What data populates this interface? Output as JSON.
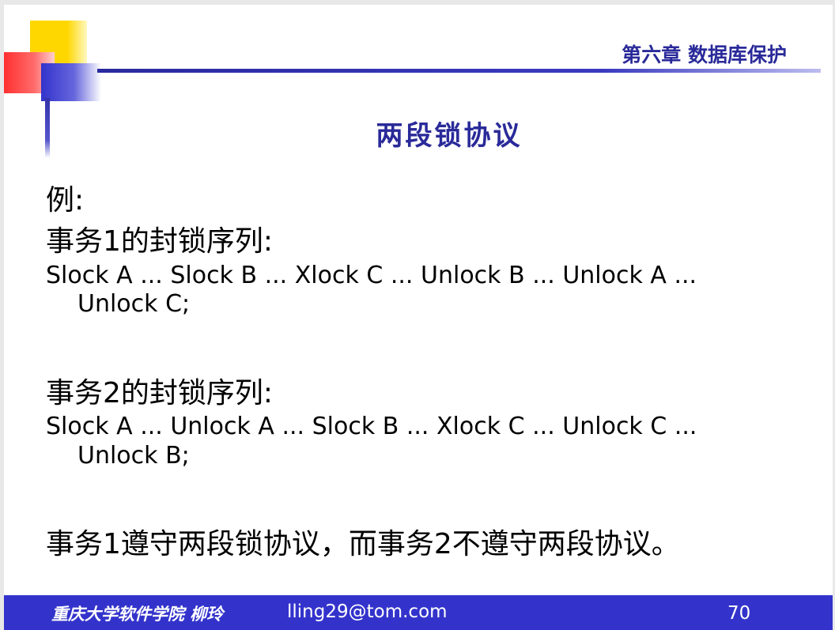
{
  "header": {
    "chapter": "第六章 数据库保护",
    "title": "两段锁协议"
  },
  "content": {
    "example_label": "例:",
    "tx1_heading": "事务1的封锁序列:",
    "tx1_seq_line1": "Slock A ... Slock B ... Xlock C ... Unlock B ... Unlock A ...",
    "tx1_seq_line2": "Unlock C;",
    "tx2_heading": "事务2的封锁序列:",
    "tx2_seq_line1": "Slock A ... Unlock A ... Slock B ... Xlock C ... Unlock C ...",
    "tx2_seq_line2": "Unlock B;",
    "conclusion": "事务1遵守两段锁协议，而事务2不遵守两段协议。"
  },
  "footer": {
    "credit": "重庆大学软件学院 柳玲",
    "email": "lling29@tom.com",
    "page_number": "70"
  },
  "colors": {
    "accent_blue": "#2a2a9a",
    "footer_blue": "#3333cc",
    "yellow": "#ffd700",
    "red": "#ff3030"
  }
}
